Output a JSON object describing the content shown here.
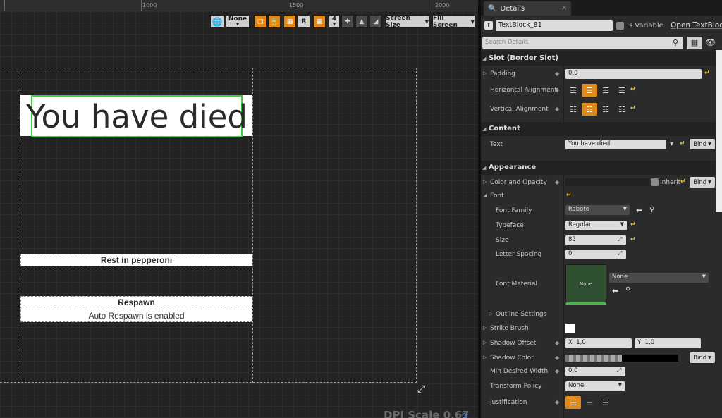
{
  "canvas": {
    "ruler": [
      "1000",
      "1500",
      "2000"
    ],
    "toolbar": {
      "locale_value": "None",
      "grid_number": "4",
      "r_label": "R",
      "screen_size_label": "Screen Size",
      "fill_screen_label": "Fill Screen"
    },
    "title_text": "You have died",
    "subtitle_text": "Rest in pepperoni",
    "respawn_text": "Respawn",
    "auto_respawn_text": "Auto Respawn is enabled",
    "dpi_scale": "DPI Scale 0.67"
  },
  "details": {
    "tab_label": "Details",
    "widget_name": "TextBlock_81",
    "is_variable_label": "Is Variable",
    "open_label": "Open TextBlock",
    "search_placeholder": "Search Details",
    "categories": {
      "slot": "Slot (Border Slot)",
      "content": "Content",
      "appearance": "Appearance"
    },
    "slot": {
      "padding_label": "Padding",
      "padding_value": "0.0",
      "halign_label": "Horizontal Alignment",
      "valign_label": "Vertical Alignment"
    },
    "content": {
      "text_label": "Text",
      "text_value": "You have died",
      "bind_label": "Bind"
    },
    "appearance": {
      "color_label": "Color and Opacity",
      "inherit_label": "Inherit",
      "bind_label": "Bind",
      "font_label": "Font",
      "font_family_label": "Font Family",
      "font_family_value": "Roboto",
      "typeface_label": "Typeface",
      "typeface_value": "Regular",
      "size_label": "Size",
      "size_value": "85",
      "letter_spacing_label": "Letter Spacing",
      "letter_spacing_value": "0",
      "font_material_label": "Font Material",
      "font_material_thumb": "None",
      "font_material_value": "None",
      "outline_label": "Outline Settings",
      "strike_label": "Strike Brush",
      "shadow_offset_label": "Shadow Offset",
      "shadow_x_label": "X",
      "shadow_x_value": "1,0",
      "shadow_y_label": "Y",
      "shadow_y_value": "1,0",
      "shadow_color_label": "Shadow Color",
      "shadow_bind_label": "Bind",
      "min_width_label": "Min Desired Width",
      "min_width_value": "0,0",
      "transform_label": "Transform Policy",
      "transform_value": "None",
      "justification_label": "Justification"
    }
  }
}
